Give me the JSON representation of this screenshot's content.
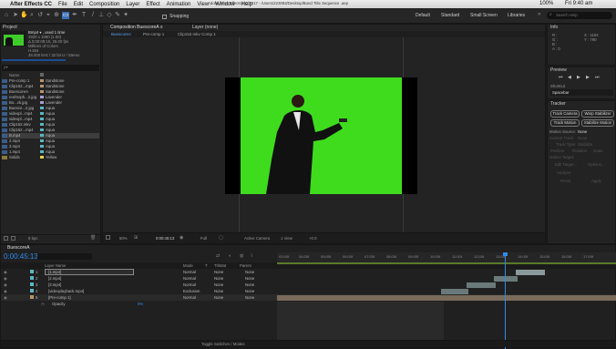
{
  "menubar": {
    "apple": "",
    "app": "After Effects CC",
    "items": [
      "File",
      "Edit",
      "Composition",
      "Layer",
      "Effect",
      "Animation",
      "View",
      "Window",
      "Help"
    ],
    "title": "Adobe After Effects CC 2017 - /Users/223093/Desktop/Bond Title Sequence .aep",
    "status": {
      "battery": "100%",
      "clock": "Fri 9:40 am"
    }
  },
  "toolbar": {
    "snapping": "Snapping",
    "workspaces": [
      "Default",
      "Standard",
      "Small Screen",
      "Libraries"
    ],
    "search_placeholder": "Search Help"
  },
  "project": {
    "tab": "Project",
    "item_name": "Bmp4 ▾ , used 1 time",
    "item_info": [
      "1920 x 1080 (1.00)",
      "Δ 0:00:08:15, 25.00 fps",
      "Millions of Colors",
      "H.264",
      "48.000 kHz / 32 bit U / Stereo"
    ],
    "search_placeholder": "ρ▾",
    "col_name": "Name",
    "col_label": "",
    "items": [
      {
        "name": "Pre-comp 1",
        "label": "Sandstone",
        "color": "#b8946c"
      },
      {
        "name": "Clip152...mp4",
        "label": "Sandstone",
        "color": "#b8946c"
      },
      {
        "name": "BuescoreA",
        "label": "Sandstone",
        "color": "#b8946c"
      },
      {
        "name": "reelSoph...2.jpg",
        "label": "Lavender",
        "color": "#a89cd0"
      },
      {
        "name": "Bo...ck.jpg",
        "label": "Lavender",
        "color": "#a89cd0"
      },
      {
        "name": "Buesce...2.jpg",
        "label": "Aqua",
        "color": "#5ab8c4"
      },
      {
        "name": "videopl...mp4",
        "label": "Aqua",
        "color": "#5ab8c4"
      },
      {
        "name": "videopl...mp4",
        "label": "Aqua",
        "color": "#5ab8c4"
      },
      {
        "name": "Clip152.mkv",
        "label": "Aqua",
        "color": "#5ab8c4"
      },
      {
        "name": "Clip152...mp4",
        "label": "Aqua",
        "color": "#5ab8c4"
      },
      {
        "name": "B.mp4",
        "label": "Aqua",
        "color": "#5ab8c4"
      },
      {
        "name": "2.mp4",
        "label": "Aqua",
        "color": "#5ab8c4"
      },
      {
        "name": "3.mp4",
        "label": "Aqua",
        "color": "#5ab8c4"
      },
      {
        "name": "1.mp4",
        "label": "Aqua",
        "color": "#5ab8c4"
      },
      {
        "name": "Solids",
        "label": "Yellow",
        "color": "#e2d04c"
      }
    ],
    "bpc": "8 bpc"
  },
  "viewer": {
    "tabs": [
      "Composition BuescoreA ≡",
      "Layer (none)"
    ],
    "subtabs": [
      "BuescoreA",
      "Pre-comp 1",
      "Clip152.mkv Comp 1"
    ],
    "footer": {
      "zoom": "50%",
      "timecode": "0:00:45:13",
      "res": "Full",
      "camera": "Active Camera",
      "view": "1 View",
      "exposure": "+0.0"
    }
  },
  "info": {
    "tab": "Info",
    "r": "R :",
    "g": "G :",
    "b": "B :",
    "a": "A : 0",
    "x": "X : 1154",
    "y": "Y : 790"
  },
  "preview": {
    "tab": "Preview",
    "shortcut_label": "Shortcut",
    "shortcut_value": "Spacebar"
  },
  "tracker": {
    "tab": "Tracker",
    "buttons": [
      "Track Camera",
      "Warp Stabilizer",
      "Track Motion",
      "Stabilize Motion"
    ],
    "motion_source_label": "Motion Source:",
    "motion_source_value": "None",
    "current_track": "Current Track:",
    "current_track_val": "None",
    "track_type": "Track Type:",
    "track_type_val": "Stabilize",
    "checks": [
      "Position",
      "Rotation",
      "Scale"
    ],
    "motion_target": "Motion Target:",
    "edit_target": "Edit Target...",
    "options": "Options...",
    "analyze": "Analyze:",
    "reset": "Reset",
    "apply": "Apply"
  },
  "timeline": {
    "tab": "BuescoreA",
    "timecode": "0:00:45:13",
    "cols": [
      "Layer Name",
      "Mode",
      "T",
      "TrkMat",
      "Parent"
    ],
    "ticks": [
      "03:00f",
      "04:00f",
      "05:00f",
      "06:00f",
      "07:00f",
      "08:00f",
      "09:00f",
      "10:00f",
      "11:00f",
      "12:00f",
      "13:00f",
      "14:00f",
      "15:00f",
      "16:00f",
      "17:00f"
    ],
    "layers": [
      {
        "num": "1",
        "name": "[1.mp4]",
        "mode": "Normal",
        "trk": "None",
        "parent": "None"
      },
      {
        "num": "2",
        "name": "[2.mp4]",
        "mode": "Normal",
        "trk": "None",
        "parent": "None"
      },
      {
        "num": "3",
        "name": "[3.mp4]",
        "mode": "Normal",
        "trk": "None",
        "parent": "None"
      },
      {
        "num": "4",
        "name": "[videoplayback.mp4]",
        "mode": "Exclusion",
        "trk": "None",
        "parent": "None"
      },
      {
        "num": "5",
        "name": "[Pre-comp 1]",
        "mode": "Normal",
        "trk": "None",
        "parent": "None"
      }
    ],
    "opacity_label": "Opacity",
    "opacity_value": "0%",
    "footer": "Toggle Switches / Modes"
  },
  "colors": {
    "accent": "#2d8ceb",
    "green": "#3fdc1e",
    "panel": "#232323"
  }
}
